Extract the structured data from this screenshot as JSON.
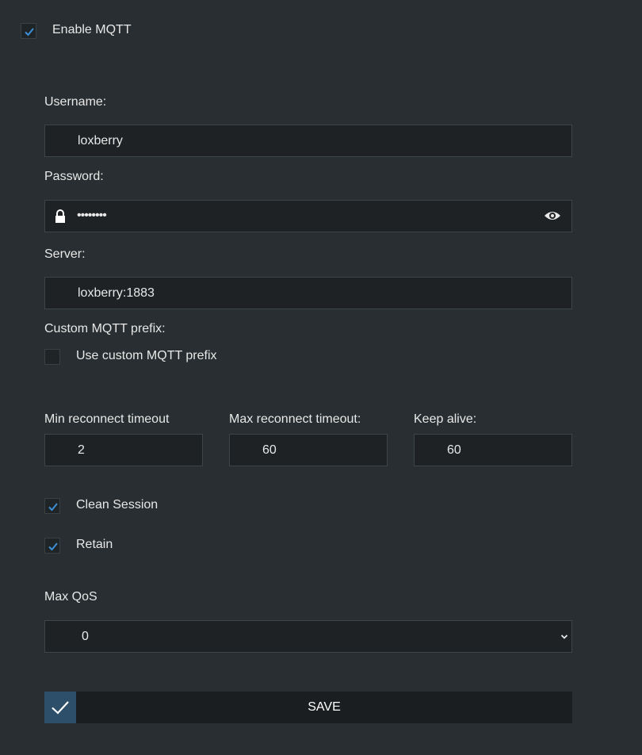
{
  "enable_mqtt": {
    "label": "Enable MQTT",
    "checked": true
  },
  "username": {
    "label": "Username:",
    "value": "loxberry"
  },
  "password": {
    "label": "Password:",
    "value": "••••••••",
    "lock_icon": "lock-icon",
    "reveal_icon": "eye-icon"
  },
  "server": {
    "label": "Server:",
    "value": "loxberry:1883"
  },
  "custom_prefix": {
    "section_label": "Custom MQTT prefix:",
    "checkbox_label": "Use custom MQTT prefix",
    "checked": false
  },
  "timeouts": {
    "min_label": "Min reconnect timeout",
    "min_value": "2",
    "max_label": "Max reconnect timeout:",
    "max_value": "60",
    "keepalive_label": "Keep alive:",
    "keepalive_value": "60"
  },
  "clean_session": {
    "label": "Clean Session",
    "checked": true
  },
  "retain": {
    "label": "Retain",
    "checked": true
  },
  "max_qos": {
    "label": "Max QoS",
    "selected": "0",
    "icon": "chevron-down-icon"
  },
  "save": {
    "label": "SAVE",
    "icon": "check-icon"
  },
  "colors": {
    "background": "#282e31",
    "field": "#1e2224",
    "accent": "#2d4f6a",
    "check": "#3b8fd6"
  }
}
